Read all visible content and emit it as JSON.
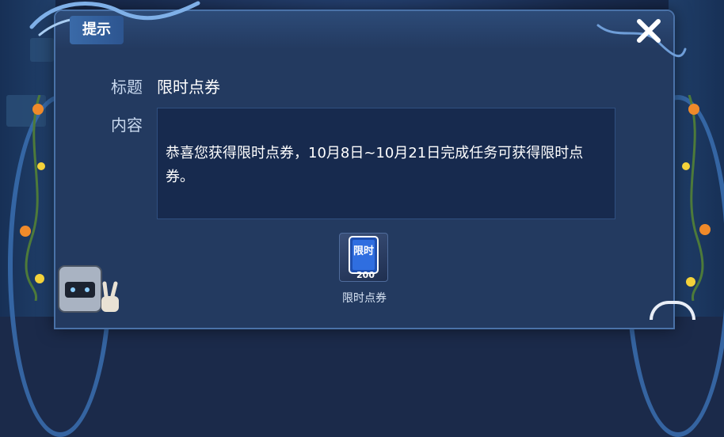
{
  "dialog": {
    "title": "提示",
    "title_field_label": "标题",
    "title_value": "限时点券",
    "content_field_label": "内容",
    "content_text": "恭喜您获得限时点券，10月8日~10月21日完成任务可获得限时点券。"
  },
  "reward": {
    "icon_text": "限时",
    "amount": "200",
    "label": "限时点券"
  },
  "icons": {
    "close": "close-icon",
    "reward": "coupon-icon"
  },
  "colors": {
    "dialog_bg": "#233a60",
    "content_bg": "#172a4e",
    "accent": "#3a6aa8"
  }
}
